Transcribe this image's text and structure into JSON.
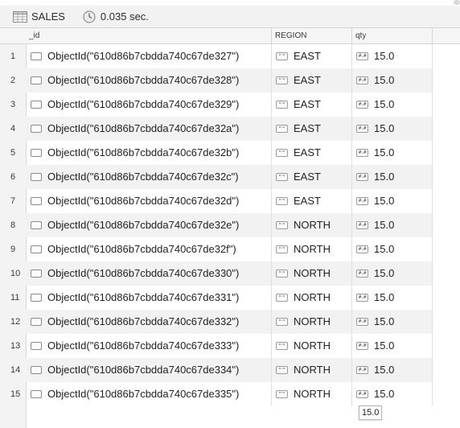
{
  "toolbar": {
    "collection": "SALES",
    "timing": "0.035 sec.",
    "icons": [
      "table-icon",
      "clock-icon"
    ]
  },
  "columns": [
    "_id",
    "REGION",
    "qty"
  ],
  "type_icons": {
    "objectid": "document-icon",
    "string": "\"\"",
    "double": "#.#"
  },
  "rows": [
    {
      "n": "1",
      "id": "ObjectId(\"610d86b7cbdda740c67de327\")",
      "region": "EAST",
      "qty": "15.0"
    },
    {
      "n": "2",
      "id": "ObjectId(\"610d86b7cbdda740c67de328\")",
      "region": "EAST",
      "qty": "15.0"
    },
    {
      "n": "3",
      "id": "ObjectId(\"610d86b7cbdda740c67de329\")",
      "region": "EAST",
      "qty": "15.0"
    },
    {
      "n": "4",
      "id": "ObjectId(\"610d86b7cbdda740c67de32a\")",
      "region": "EAST",
      "qty": "15.0"
    },
    {
      "n": "5",
      "id": "ObjectId(\"610d86b7cbdda740c67de32b\")",
      "region": "EAST",
      "qty": "15.0"
    },
    {
      "n": "6",
      "id": "ObjectId(\"610d86b7cbdda740c67de32c\")",
      "region": "EAST",
      "qty": "15.0"
    },
    {
      "n": "7",
      "id": "ObjectId(\"610d86b7cbdda740c67de32d\")",
      "region": "EAST",
      "qty": "15.0"
    },
    {
      "n": "8",
      "id": "ObjectId(\"610d86b7cbdda740c67de32e\")",
      "region": "NORTH",
      "qty": "15.0"
    },
    {
      "n": "9",
      "id": "ObjectId(\"610d86b7cbdda740c67de32f\")",
      "region": "NORTH",
      "qty": "15.0"
    },
    {
      "n": "10",
      "id": "ObjectId(\"610d86b7cbdda740c67de330\")",
      "region": "NORTH",
      "qty": "15.0"
    },
    {
      "n": "11",
      "id": "ObjectId(\"610d86b7cbdda740c67de331\")",
      "region": "NORTH",
      "qty": "15.0"
    },
    {
      "n": "12",
      "id": "ObjectId(\"610d86b7cbdda740c67de332\")",
      "region": "NORTH",
      "qty": "15.0"
    },
    {
      "n": "13",
      "id": "ObjectId(\"610d86b7cbdda740c67de333\")",
      "region": "NORTH",
      "qty": "15.0"
    },
    {
      "n": "14",
      "id": "ObjectId(\"610d86b7cbdda740c67de334\")",
      "region": "NORTH",
      "qty": "15.0"
    },
    {
      "n": "15",
      "id": "ObjectId(\"610d86b7cbdda740c67de335\")",
      "region": "NORTH",
      "qty": "15.0"
    }
  ],
  "tooltip": "15.0"
}
